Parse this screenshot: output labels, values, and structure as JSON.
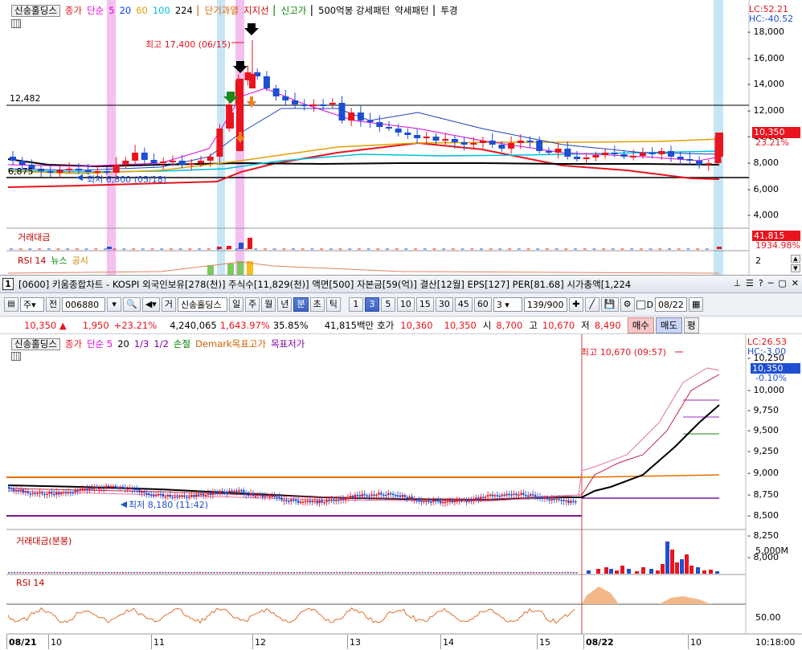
{
  "top": {
    "legend": {
      "name": "신송홀딩스",
      "price": "종가",
      "ma_label": "단순",
      "ma": [
        {
          "v": "5",
          "color": "#e000e0"
        },
        {
          "v": "20",
          "color": "#0040ff"
        },
        {
          "v": "60",
          "color": "#e0a000"
        },
        {
          "v": "100",
          "color": "#00c0e0"
        },
        {
          "v": "224",
          "color": "#000000"
        }
      ],
      "overheat": "단기과열",
      "support": "지지선",
      "newhigh": "신고가",
      "pattern": "500억봉 강세패턴",
      "weak": "약세패턴",
      "warn": "투경"
    },
    "right_badges": {
      "lc": "LC:52.21",
      "hc": "HC:-40.52"
    },
    "yticks": [
      "18,000",
      "16,000",
      "14,000",
      "12,000",
      "10,000",
      "8,000",
      "6,000",
      "4,000"
    ],
    "price_tag": {
      "value": "10,350",
      "pct": "23.21%"
    },
    "level_12482": "12,482",
    "level_6875": "6,875",
    "hi_annot": "최고 17,400 (06/15)",
    "lo_annot": "최저 6,800 (05/18)",
    "vol_title": "거래대금",
    "vol_tag": {
      "value": "41,815",
      "pct": "1934.98%"
    },
    "rsi_title": "RSI 14",
    "rsi_news": "뉴스",
    "rsi_disc": "공시",
    "rsi_tick": "2"
  },
  "titlebar": {
    "num": "1",
    "title": "[0600] 키움종합차트 - KOSPI 외국인보유[278(천)] 주식수[11,829(천)] 액면[500] 자본금[59(억)] 결산[12월] EPS[127] PER[81.68] 시가총액[1,224"
  },
  "toolbar": {
    "ju": "주",
    "jeon": "전",
    "code": "006880",
    "geo": "거",
    "name": "신송홀딩스",
    "periods": [
      "일",
      "주",
      "월",
      "년",
      "분",
      "초",
      "틱"
    ],
    "nums": [
      "1",
      "3",
      "5",
      "10",
      "15",
      "30",
      "45",
      "60"
    ],
    "interval": "3",
    "count": "139/900",
    "d_label": "D",
    "date": "08/22"
  },
  "quote": {
    "price": "10,350",
    "change": "1,950",
    "pct": "+23.21%",
    "vol": "4,240,065",
    "vol_pct": "1,643.97%",
    "turn": "35.85%",
    "amount": "41,815백만",
    "bid_lbl": "호가",
    "bid": "10,360",
    "ask": "10,350",
    "open_lbl": "시",
    "open": "8,700",
    "high_lbl": "고",
    "high": "10,670",
    "low_lbl": "저",
    "low": "8,490",
    "buy": "매수",
    "sell": "매도",
    "flat": "평"
  },
  "bottom": {
    "legend": {
      "name": "신송홀딩스",
      "price": "종가",
      "ma_label": "단순 5",
      "ma20": "20",
      "third": "1/3",
      "half": "1/2",
      "stop": "손절",
      "demark_hi": "Demark목표고가",
      "demark_lo": "목표저가"
    },
    "right_badges": {
      "lc": "LC:26.53",
      "hc": "HC:-3.00"
    },
    "yticks": [
      "10,250",
      "10,000",
      "9,750",
      "9,500",
      "9,250",
      "9,000",
      "8,750",
      "8,500",
      "8,250",
      "8,000"
    ],
    "price_tag": {
      "value": "10,350",
      "pct": "-0.10%"
    },
    "hi_annot": "최고 10,670 (09:57)",
    "lo_annot": "최저 8,180 (11:42)",
    "vol_title": "거래대금(분봉)",
    "vol_tick": "5,000M",
    "rsi_title": "RSI 14",
    "rsi_tick": "50.00"
  },
  "xaxis": {
    "labels": [
      "08/21",
      "10",
      "11",
      "12",
      "13",
      "14",
      "15",
      "08/22",
      "10"
    ],
    "time": "10:18:00"
  },
  "colors": {
    "up": "#e8141e",
    "down": "#1d4fd0",
    "accent": "#3d63c4"
  }
}
